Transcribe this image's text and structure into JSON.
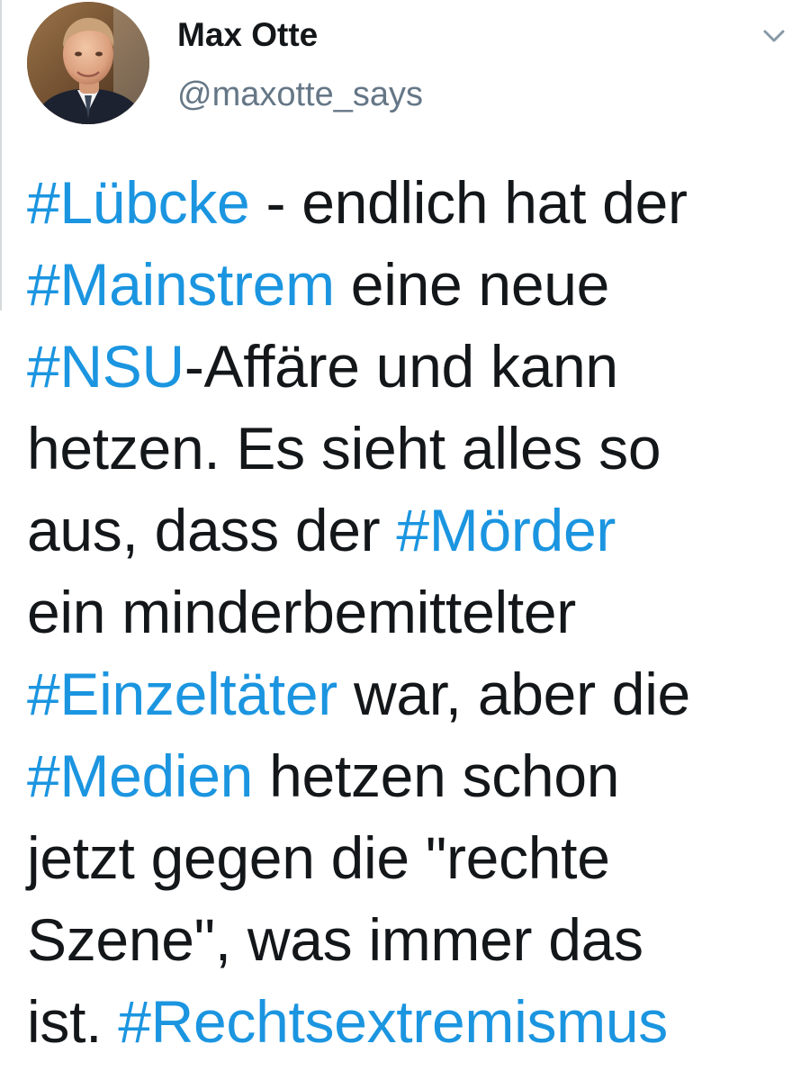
{
  "author": {
    "display_name": "Max Otte",
    "handle": "@maxotte_says",
    "avatar_icon": "profile-photo"
  },
  "menu": {
    "icon": "chevron-down-icon"
  },
  "colors": {
    "text": "#14171a",
    "secondary": "#657786",
    "link": "#1b95e0"
  },
  "tweet": {
    "lines": [
      [
        {
          "text": "#Lübcke",
          "hashtag": true
        },
        {
          "text": " - endlich hat der",
          "hashtag": false
        }
      ],
      [
        {
          "text": "#Mainstrem",
          "hashtag": true
        },
        {
          "text": " eine neue",
          "hashtag": false
        }
      ],
      [
        {
          "text": "#NSU",
          "hashtag": true
        },
        {
          "text": "-Affäre und kann",
          "hashtag": false
        }
      ],
      [
        {
          "text": "hetzen. Es sieht alles so",
          "hashtag": false
        }
      ],
      [
        {
          "text": "aus, dass der ",
          "hashtag": false
        },
        {
          "text": "#Mörder",
          "hashtag": true
        }
      ],
      [
        {
          "text": "ein minderbemittelter",
          "hashtag": false
        }
      ],
      [
        {
          "text": "#Einzeltäter",
          "hashtag": true
        },
        {
          "text": " war, aber die",
          "hashtag": false
        }
      ],
      [
        {
          "text": "#Medien",
          "hashtag": true
        },
        {
          "text": " hetzen schon",
          "hashtag": false
        }
      ],
      [
        {
          "text": "jetzt gegen die \"rechte",
          "hashtag": false
        }
      ],
      [
        {
          "text": "Szene\", was immer das",
          "hashtag": false
        }
      ],
      [
        {
          "text": "ist. ",
          "hashtag": false
        },
        {
          "text": "#Rechtsextremismus",
          "hashtag": true
        }
      ]
    ]
  }
}
